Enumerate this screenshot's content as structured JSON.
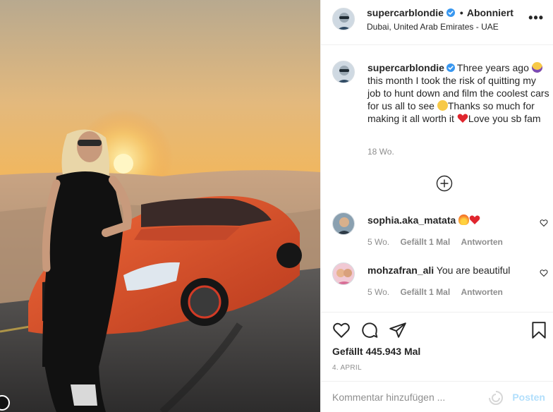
{
  "post": {
    "username": "supercarblondie",
    "follow_status": "Abonniert",
    "location": "Dubai, United Arab Emirates - UAE",
    "more_label": "•••"
  },
  "caption": {
    "username": "supercarblondie",
    "text_1": "Three years ago",
    "text_2": " this month I took the risk of quitting my job to hunt down and film the coolest cars for us all to see ",
    "text_3": "Thanks so much for making it all worth it ",
    "text_4": "Love you sb fam",
    "emojis": [
      "face-screaming-emoji",
      "smiling-face-emoji",
      "red-heart-emoji"
    ],
    "time": "18 Wo."
  },
  "comments": [
    {
      "username": "sophia.aka_matata",
      "text": "",
      "emojis": [
        "fire-emoji",
        "red-heart-emoji"
      ],
      "time": "5 Wo.",
      "likes": "Gefällt 1 Mal",
      "reply": "Antworten"
    },
    {
      "username": "mohzafran_ali",
      "text": "You are beautiful",
      "time": "5 Wo.",
      "likes": "Gefällt 1 Mal",
      "reply": "Antworten"
    }
  ],
  "actions": {
    "icons": [
      "heart-icon",
      "comment-icon",
      "share-icon",
      "bookmark-icon"
    ],
    "likes": "Gefällt 445.943 Mal",
    "date": "4. APRIL"
  },
  "comment_box": {
    "placeholder": "Kommentar hinzufügen ...",
    "post_label": "Posten"
  },
  "colors": {
    "verified": "#3897f0",
    "post_button": "#b2dffc",
    "secondary_text": "#8e8e8e",
    "car": "#e2542c"
  }
}
